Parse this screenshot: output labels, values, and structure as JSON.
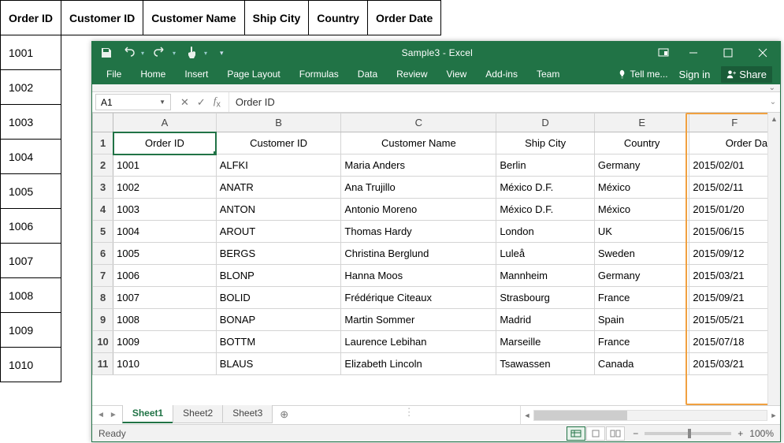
{
  "bg_table": {
    "headers": [
      "Order ID",
      "Customer ID",
      "Customer Name",
      "Ship City",
      "Country",
      "Order Date"
    ],
    "ids": [
      "1001",
      "1002",
      "1003",
      "1004",
      "1005",
      "1006",
      "1007",
      "1008",
      "1009",
      "1010"
    ]
  },
  "excel": {
    "title": "Sample3 - Excel",
    "ribbon": {
      "tabs": [
        "File",
        "Home",
        "Insert",
        "Page Layout",
        "Formulas",
        "Data",
        "Review",
        "View",
        "Add-ins",
        "Team"
      ],
      "tell_me": "Tell me...",
      "sign_in": "Sign in",
      "share": "Share"
    },
    "namebox": "A1",
    "formula": "Order ID",
    "columns": [
      "A",
      "B",
      "C",
      "D",
      "E",
      "F"
    ],
    "sheet_headers": [
      "Order ID",
      "Customer ID",
      "Customer Name",
      "Ship City",
      "Country",
      "Order Date"
    ],
    "rows": [
      {
        "n": "2",
        "a": "1001",
        "b": "ALFKI",
        "c": "Maria Anders",
        "d": "Berlin",
        "e": "Germany",
        "f": "2015/02/01"
      },
      {
        "n": "3",
        "a": "1002",
        "b": "ANATR",
        "c": "Ana Trujillo",
        "d": "México D.F.",
        "e": "México",
        "f": "2015/02/11"
      },
      {
        "n": "4",
        "a": "1003",
        "b": "ANTON",
        "c": "Antonio Moreno",
        "d": "México D.F.",
        "e": "México",
        "f": "2015/01/20"
      },
      {
        "n": "5",
        "a": "1004",
        "b": "AROUT",
        "c": "Thomas Hardy",
        "d": "London",
        "e": "UK",
        "f": "2015/06/15"
      },
      {
        "n": "6",
        "a": "1005",
        "b": "BERGS",
        "c": "Christina Berglund",
        "d": "Luleå",
        "e": "Sweden",
        "f": "2015/09/12"
      },
      {
        "n": "7",
        "a": "1006",
        "b": "BLONP",
        "c": "Hanna Moos",
        "d": "Mannheim",
        "e": "Germany",
        "f": "2015/03/21"
      },
      {
        "n": "8",
        "a": "1007",
        "b": "BOLID",
        "c": "Frédérique Citeaux",
        "d": "Strasbourg",
        "e": "France",
        "f": "2015/09/21"
      },
      {
        "n": "9",
        "a": "1008",
        "b": "BONAP",
        "c": "Martin Sommer",
        "d": "Madrid",
        "e": "Spain",
        "f": "2015/05/21"
      },
      {
        "n": "10",
        "a": "1009",
        "b": "BOTTM",
        "c": "Laurence Lebihan",
        "d": "Marseille",
        "e": "France",
        "f": "2015/07/18"
      },
      {
        "n": "11",
        "a": "1010",
        "b": "BLAUS",
        "c": "Elizabeth Lincoln",
        "d": "Tsawassen",
        "e": "Canada",
        "f": "2015/03/21"
      }
    ],
    "sheets": {
      "active": "Sheet1",
      "others": [
        "Sheet2",
        "Sheet3"
      ]
    },
    "status": {
      "ready": "Ready",
      "zoom": "100%"
    }
  }
}
